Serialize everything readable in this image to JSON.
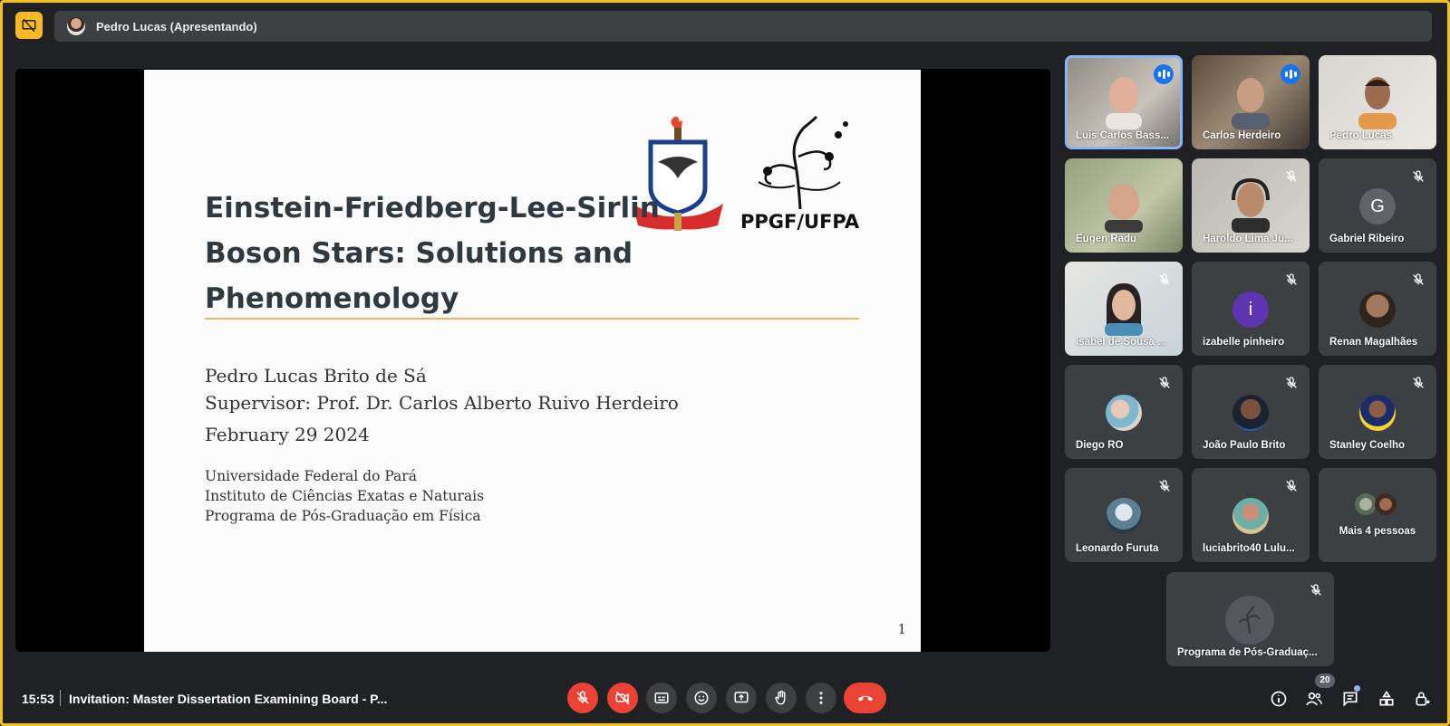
{
  "top_bar": {
    "presenter_label": "Pedro Lucas (Apresentando)"
  },
  "slide": {
    "title_line1": "Einstein-Friedberg-Lee-Sirlin",
    "title_line2": "Boson Stars:  Solutions and Phenomenology",
    "author": "Pedro Lucas Brito de Sá",
    "supervisor": "Supervisor:  Prof.  Dr.  Carlos Alberto Ruivo Herdeiro",
    "date": "February 29 2024",
    "institution1": "Universidade Federal do Pará",
    "institution2": "Instituto de Ciências Exatas e Naturais",
    "institution3": "Programa de Pós-Graduação em Física",
    "page_number": "1",
    "logo_right_text": "PPGF/UFPA",
    "logo_left_text": "UNIVERSIDADE FEDERAL DO PARÁ"
  },
  "participants": [
    {
      "name": "Luis Carlos Bass...",
      "state": "speaking"
    },
    {
      "name": "Carlos Herdeiro",
      "state": "speaking"
    },
    {
      "name": "Pedro Lucas",
      "state": "none"
    },
    {
      "name": "Eugen Radu",
      "state": "none"
    },
    {
      "name": "Haroldo Lima Ju...",
      "state": "muted"
    },
    {
      "name": "Gabriel Ribeiro",
      "state": "muted",
      "initial": "G"
    },
    {
      "name": "Isabel de Sousa ...",
      "state": "muted"
    },
    {
      "name": "izabelle pinheiro",
      "state": "muted",
      "initial": "i"
    },
    {
      "name": "Renan Magalhães",
      "state": "muted"
    },
    {
      "name": "Diego RO",
      "state": "muted"
    },
    {
      "name": "João Paulo Brito",
      "state": "muted"
    },
    {
      "name": "Stanley Coelho",
      "state": "muted"
    },
    {
      "name": "Leonardo Furuta",
      "state": "muted"
    },
    {
      "name": "luciabrito40 Lulu...",
      "state": "muted"
    },
    {
      "name": "Mais 4 pessoas",
      "state": "none"
    },
    {
      "name": "Programa de Pós-Graduaç...",
      "state": "muted"
    }
  ],
  "bottom_bar": {
    "time": "15:53",
    "meeting_title": "Invitation: Master Dissertation Examining Board - P...",
    "participant_count": "20",
    "controls": [
      "mic-off",
      "camera-off",
      "captions",
      "emoji",
      "present",
      "raise-hand",
      "more",
      "leave-call"
    ],
    "right_controls": [
      "info",
      "people",
      "chat",
      "activities",
      "host-controls"
    ]
  },
  "colors": {
    "accent_blue": "#1a73e8",
    "danger_red": "#ea4335",
    "present_yellow": "#f9ba22",
    "slide_rule": "#f0b45c",
    "avatar_gabriel": "#5f6368",
    "avatar_izabelle": "#5e35b1"
  }
}
